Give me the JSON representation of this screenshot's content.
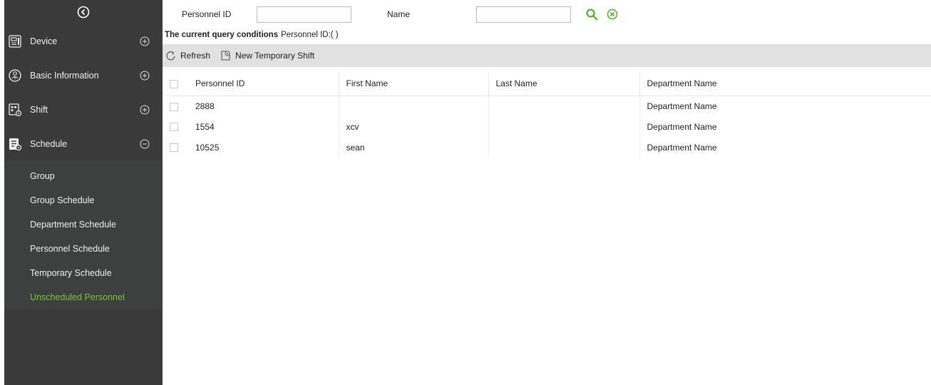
{
  "sidebar": {
    "menu": [
      {
        "label": "Device",
        "icon": "device-icon",
        "toggle": "plus"
      },
      {
        "label": "Basic Information",
        "icon": "basic-information-icon",
        "toggle": "plus"
      },
      {
        "label": "Shift",
        "icon": "shift-icon",
        "toggle": "plus"
      },
      {
        "label": "Schedule",
        "icon": "schedule-icon",
        "toggle": "minus"
      }
    ],
    "submenu": [
      {
        "label": "Group"
      },
      {
        "label": "Group Schedule"
      },
      {
        "label": "Department Schedule"
      },
      {
        "label": "Personnel Schedule"
      },
      {
        "label": "Temporary Schedule"
      },
      {
        "label": "Unscheduled Personnel",
        "active": true
      }
    ]
  },
  "search": {
    "personnel_id_label": "Personnel ID",
    "personnel_id_value": "",
    "name_label": "Name",
    "name_value": ""
  },
  "query": {
    "prefix": "The current query conditions",
    "conditions": "Personnel ID:( )"
  },
  "toolbar": {
    "refresh_label": "Refresh",
    "new_temp_shift_label": "New Temporary Shift"
  },
  "table": {
    "columns": [
      "Personnel ID",
      "First Name",
      "Last Name",
      "Department Name"
    ],
    "rows": [
      [
        "2888",
        "",
        "",
        "Department Name"
      ],
      [
        "1554",
        "xcv",
        "",
        "Department Name"
      ],
      [
        "10525",
        "sean",
        "",
        "Department Name"
      ]
    ]
  },
  "colors": {
    "sidebar_bg": "#3a3a3a",
    "active_green": "#7ac143",
    "search_green": "#5cb531",
    "toolbar_bg": "#e1e1e1"
  }
}
